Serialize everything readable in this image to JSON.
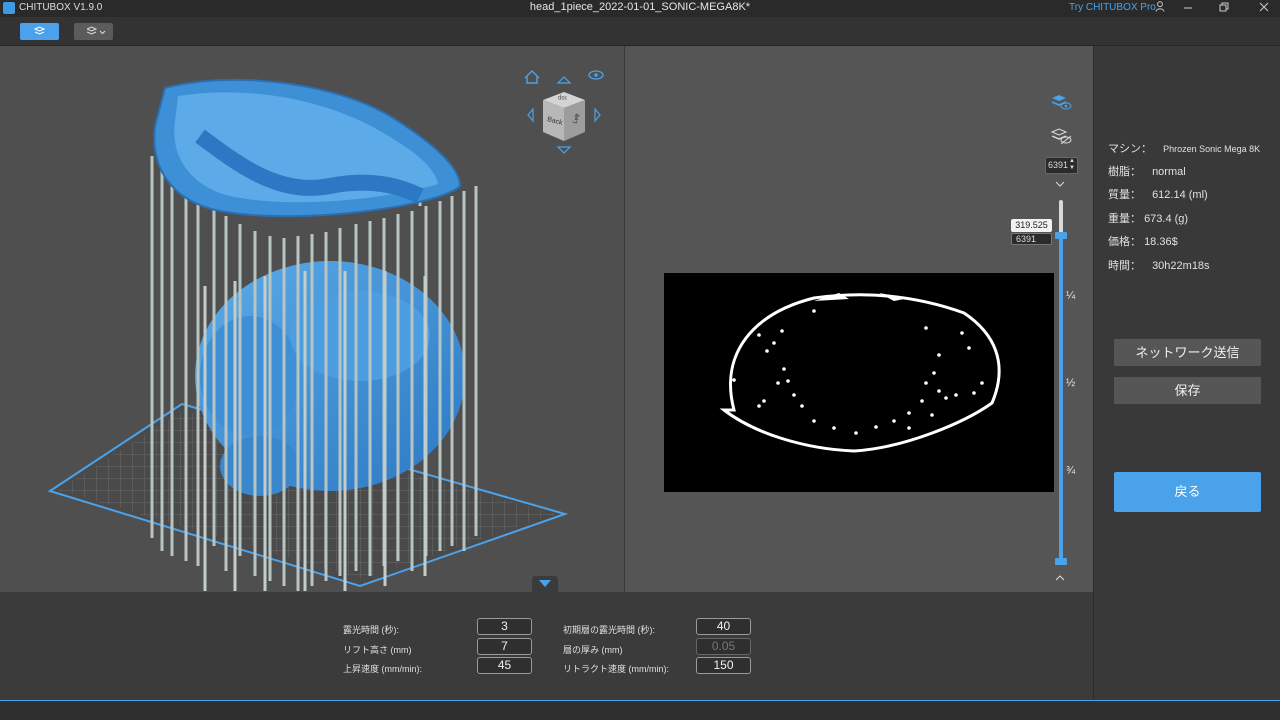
{
  "titlebar": {
    "app_version": "CHITUBOX V1.9.0",
    "document_title": "head_1piece_2022-01-01_SONIC-MEGA8K*",
    "try_pro": "Try CHITUBOX Pro"
  },
  "view_cube": {
    "top": "Top",
    "back": "Back",
    "left": "Left"
  },
  "layer_slider": {
    "top_layer": "6391",
    "current_height": "319.525",
    "current_layer": "6391",
    "fractions": [
      "¼",
      "½",
      "¾"
    ]
  },
  "info": {
    "machine_label": "マシン：",
    "machine_value": "Phrozen Sonic Mega 8K",
    "resin_label": "樹脂：",
    "resin_value": "normal",
    "mass_label": "質量：",
    "mass_value": "612.14  (ml)",
    "weight_label": "重量：",
    "weight_value": "673.4  (g)",
    "price_label": "価格：",
    "price_value": "18.36$",
    "time_label": "時間：",
    "time_value": "30h22m18s"
  },
  "actions": {
    "network_send": "ネットワーク送信",
    "save": "保存",
    "back": "戻る"
  },
  "params": {
    "exposure_time_label": "露光時間 (秒):",
    "exposure_time_value": "3",
    "bottom_exposure_label": "初期層の露光時間 (秒):",
    "bottom_exposure_value": "40",
    "lift_height_label": "リフト高さ (mm)",
    "lift_height_value": "7",
    "layer_thickness_label": "層の厚み (mm)",
    "layer_thickness_value": "0.05",
    "lift_speed_label": "上昇速度 (mm/min):",
    "lift_speed_value": "45",
    "retract_speed_label": "リトラクト速度 (mm/min):",
    "retract_speed_value": "150"
  },
  "colors": {
    "accent": "#4aa3ea",
    "model_blue": "#3d8fd6",
    "support": "#b8c4c2"
  }
}
